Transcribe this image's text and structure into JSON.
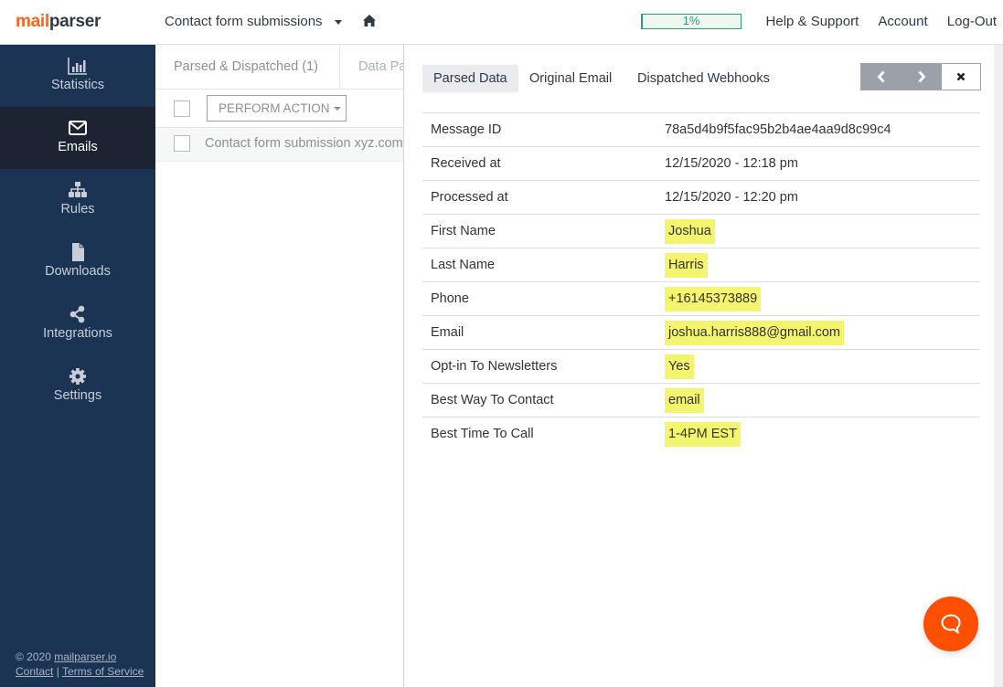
{
  "header": {
    "logo": {
      "part1": "mail",
      "part2": "parser"
    },
    "mailbox_name": "Contact form submissions",
    "quota": {
      "label": "1%",
      "percent": 1,
      "color": "#2e9b7b"
    },
    "links": [
      "Help & Support",
      "Account",
      "Log-Out"
    ]
  },
  "sidebar": {
    "items": [
      {
        "label": "Statistics",
        "icon": "bar-chart-icon",
        "active": false
      },
      {
        "label": "Emails",
        "icon": "envelope-icon",
        "active": true
      },
      {
        "label": "Rules",
        "icon": "sitemap-icon",
        "active": false
      },
      {
        "label": "Downloads",
        "icon": "file-icon",
        "active": false
      },
      {
        "label": "Integrations",
        "icon": "share-icon",
        "active": false
      },
      {
        "label": "Settings",
        "icon": "gear-icon",
        "active": false
      }
    ],
    "footer": {
      "copyright": "© 2020 ",
      "site_link": "mailparser.io",
      "contact_link": "Contact",
      "separator": " | ",
      "terms_link": "Terms of Service"
    }
  },
  "email_list": {
    "tabs": [
      "Parsed & Dispatched (1)",
      "Data Pa"
    ],
    "perform_action_label": "PERFORM ACTION",
    "emails": [
      {
        "subject": "Contact form submission xyz.com"
      }
    ]
  },
  "detail": {
    "tabs": [
      {
        "label": "Parsed Data",
        "active": true
      },
      {
        "label": "Original Email",
        "active": false
      },
      {
        "label": "Dispatched Webhooks",
        "active": false
      }
    ],
    "highlight_color": "#f4f56f",
    "rows": [
      {
        "field": "Message ID",
        "value": "78a5d4b9f5fac95b2b4ae4aa9d8c99c4",
        "highlight": false
      },
      {
        "field": "Received at",
        "value": "12/15/2020 - 12:18 pm",
        "highlight": false
      },
      {
        "field": "Processed at",
        "value": "12/15/2020 - 12:20 pm",
        "highlight": false
      },
      {
        "field": "First Name",
        "value": "Joshua",
        "highlight": true
      },
      {
        "field": "Last Name",
        "value": "Harris",
        "highlight": true
      },
      {
        "field": "Phone",
        "value": "+16145373889",
        "highlight": true
      },
      {
        "field": "Email",
        "value": "joshua.harris888@gmail.com",
        "highlight": true
      },
      {
        "field": "Opt-in To Newsletters",
        "value": "Yes",
        "highlight": true
      },
      {
        "field": "Best Way To Contact",
        "value": "email",
        "highlight": true
      },
      {
        "field": "Best Time To Call",
        "value": "1-4PM EST",
        "highlight": true
      }
    ]
  },
  "chat_widget": {
    "color": "#ff4f00",
    "icon": "chat-bubble-icon"
  }
}
